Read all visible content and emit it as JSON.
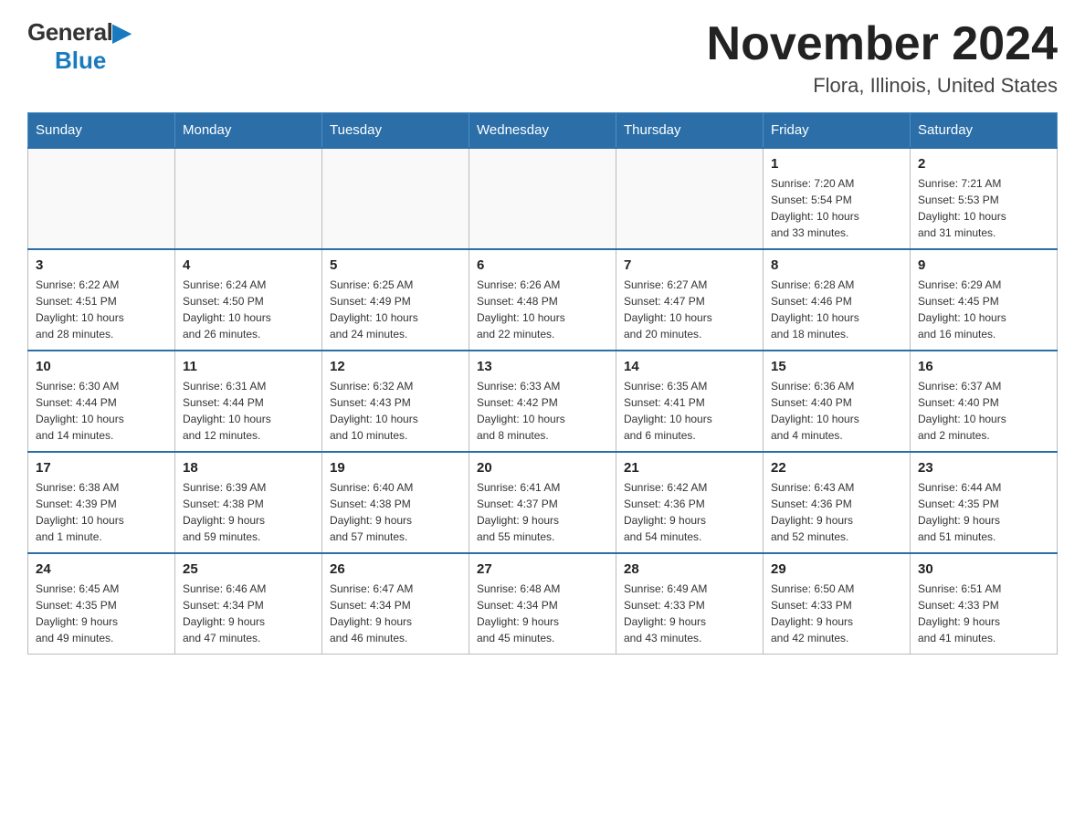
{
  "logo": {
    "general": "General",
    "blue": "Blue"
  },
  "title": "November 2024",
  "subtitle": "Flora, Illinois, United States",
  "days_of_week": [
    "Sunday",
    "Monday",
    "Tuesday",
    "Wednesday",
    "Thursday",
    "Friday",
    "Saturday"
  ],
  "weeks": [
    [
      {
        "day": "",
        "info": ""
      },
      {
        "day": "",
        "info": ""
      },
      {
        "day": "",
        "info": ""
      },
      {
        "day": "",
        "info": ""
      },
      {
        "day": "",
        "info": ""
      },
      {
        "day": "1",
        "info": "Sunrise: 7:20 AM\nSunset: 5:54 PM\nDaylight: 10 hours\nand 33 minutes."
      },
      {
        "day": "2",
        "info": "Sunrise: 7:21 AM\nSunset: 5:53 PM\nDaylight: 10 hours\nand 31 minutes."
      }
    ],
    [
      {
        "day": "3",
        "info": "Sunrise: 6:22 AM\nSunset: 4:51 PM\nDaylight: 10 hours\nand 28 minutes."
      },
      {
        "day": "4",
        "info": "Sunrise: 6:24 AM\nSunset: 4:50 PM\nDaylight: 10 hours\nand 26 minutes."
      },
      {
        "day": "5",
        "info": "Sunrise: 6:25 AM\nSunset: 4:49 PM\nDaylight: 10 hours\nand 24 minutes."
      },
      {
        "day": "6",
        "info": "Sunrise: 6:26 AM\nSunset: 4:48 PM\nDaylight: 10 hours\nand 22 minutes."
      },
      {
        "day": "7",
        "info": "Sunrise: 6:27 AM\nSunset: 4:47 PM\nDaylight: 10 hours\nand 20 minutes."
      },
      {
        "day": "8",
        "info": "Sunrise: 6:28 AM\nSunset: 4:46 PM\nDaylight: 10 hours\nand 18 minutes."
      },
      {
        "day": "9",
        "info": "Sunrise: 6:29 AM\nSunset: 4:45 PM\nDaylight: 10 hours\nand 16 minutes."
      }
    ],
    [
      {
        "day": "10",
        "info": "Sunrise: 6:30 AM\nSunset: 4:44 PM\nDaylight: 10 hours\nand 14 minutes."
      },
      {
        "day": "11",
        "info": "Sunrise: 6:31 AM\nSunset: 4:44 PM\nDaylight: 10 hours\nand 12 minutes."
      },
      {
        "day": "12",
        "info": "Sunrise: 6:32 AM\nSunset: 4:43 PM\nDaylight: 10 hours\nand 10 minutes."
      },
      {
        "day": "13",
        "info": "Sunrise: 6:33 AM\nSunset: 4:42 PM\nDaylight: 10 hours\nand 8 minutes."
      },
      {
        "day": "14",
        "info": "Sunrise: 6:35 AM\nSunset: 4:41 PM\nDaylight: 10 hours\nand 6 minutes."
      },
      {
        "day": "15",
        "info": "Sunrise: 6:36 AM\nSunset: 4:40 PM\nDaylight: 10 hours\nand 4 minutes."
      },
      {
        "day": "16",
        "info": "Sunrise: 6:37 AM\nSunset: 4:40 PM\nDaylight: 10 hours\nand 2 minutes."
      }
    ],
    [
      {
        "day": "17",
        "info": "Sunrise: 6:38 AM\nSunset: 4:39 PM\nDaylight: 10 hours\nand 1 minute."
      },
      {
        "day": "18",
        "info": "Sunrise: 6:39 AM\nSunset: 4:38 PM\nDaylight: 9 hours\nand 59 minutes."
      },
      {
        "day": "19",
        "info": "Sunrise: 6:40 AM\nSunset: 4:38 PM\nDaylight: 9 hours\nand 57 minutes."
      },
      {
        "day": "20",
        "info": "Sunrise: 6:41 AM\nSunset: 4:37 PM\nDaylight: 9 hours\nand 55 minutes."
      },
      {
        "day": "21",
        "info": "Sunrise: 6:42 AM\nSunset: 4:36 PM\nDaylight: 9 hours\nand 54 minutes."
      },
      {
        "day": "22",
        "info": "Sunrise: 6:43 AM\nSunset: 4:36 PM\nDaylight: 9 hours\nand 52 minutes."
      },
      {
        "day": "23",
        "info": "Sunrise: 6:44 AM\nSunset: 4:35 PM\nDaylight: 9 hours\nand 51 minutes."
      }
    ],
    [
      {
        "day": "24",
        "info": "Sunrise: 6:45 AM\nSunset: 4:35 PM\nDaylight: 9 hours\nand 49 minutes."
      },
      {
        "day": "25",
        "info": "Sunrise: 6:46 AM\nSunset: 4:34 PM\nDaylight: 9 hours\nand 47 minutes."
      },
      {
        "day": "26",
        "info": "Sunrise: 6:47 AM\nSunset: 4:34 PM\nDaylight: 9 hours\nand 46 minutes."
      },
      {
        "day": "27",
        "info": "Sunrise: 6:48 AM\nSunset: 4:34 PM\nDaylight: 9 hours\nand 45 minutes."
      },
      {
        "day": "28",
        "info": "Sunrise: 6:49 AM\nSunset: 4:33 PM\nDaylight: 9 hours\nand 43 minutes."
      },
      {
        "day": "29",
        "info": "Sunrise: 6:50 AM\nSunset: 4:33 PM\nDaylight: 9 hours\nand 42 minutes."
      },
      {
        "day": "30",
        "info": "Sunrise: 6:51 AM\nSunset: 4:33 PM\nDaylight: 9 hours\nand 41 minutes."
      }
    ]
  ]
}
